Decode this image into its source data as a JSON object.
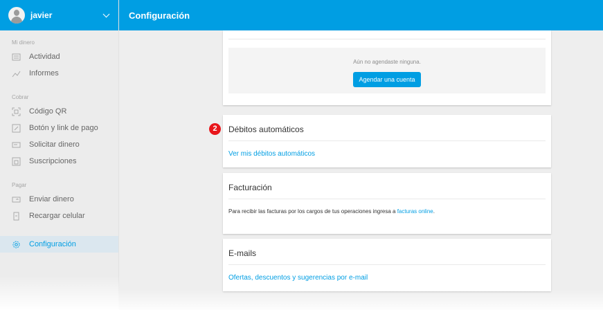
{
  "user": {
    "name": "javier"
  },
  "header": {
    "title": "Configuración"
  },
  "sidebar": {
    "sections": [
      {
        "title": "Mi dinero",
        "items": [
          {
            "label": "Actividad",
            "icon": "list-icon"
          },
          {
            "label": "Informes",
            "icon": "chart-icon"
          }
        ]
      },
      {
        "title": "Cobrar",
        "items": [
          {
            "label": "Código QR",
            "icon": "qr-icon"
          },
          {
            "label": "Botón y link de pago",
            "icon": "link-icon"
          },
          {
            "label": "Solicitar dinero",
            "icon": "request-money-icon"
          },
          {
            "label": "Suscripciones",
            "icon": "subscription-icon"
          }
        ]
      },
      {
        "title": "Pagar",
        "items": [
          {
            "label": "Enviar dinero",
            "icon": "send-money-icon"
          },
          {
            "label": "Recargar celular",
            "icon": "phone-icon"
          }
        ]
      }
    ],
    "settings": {
      "label": "Configuración",
      "icon": "gear-icon"
    }
  },
  "scheduled_accounts": {
    "empty_text": "Aún no agendaste ninguna.",
    "button_label": "Agendar una cuenta"
  },
  "annotation": {
    "badge": "2"
  },
  "debits": {
    "title": "Débitos automáticos",
    "link": "Ver mis débitos automáticos"
  },
  "billing": {
    "title": "Facturación",
    "text": "Para recibir las facturas por los cargos de tus operaciones ingresa a ",
    "link": "facturas online",
    "suffix": "."
  },
  "emails": {
    "title": "E-mails",
    "link": "Ofertas, descuentos y sugerencias por e-mail"
  },
  "colors": {
    "brand": "#009ee3",
    "badge": "#e8161b"
  }
}
